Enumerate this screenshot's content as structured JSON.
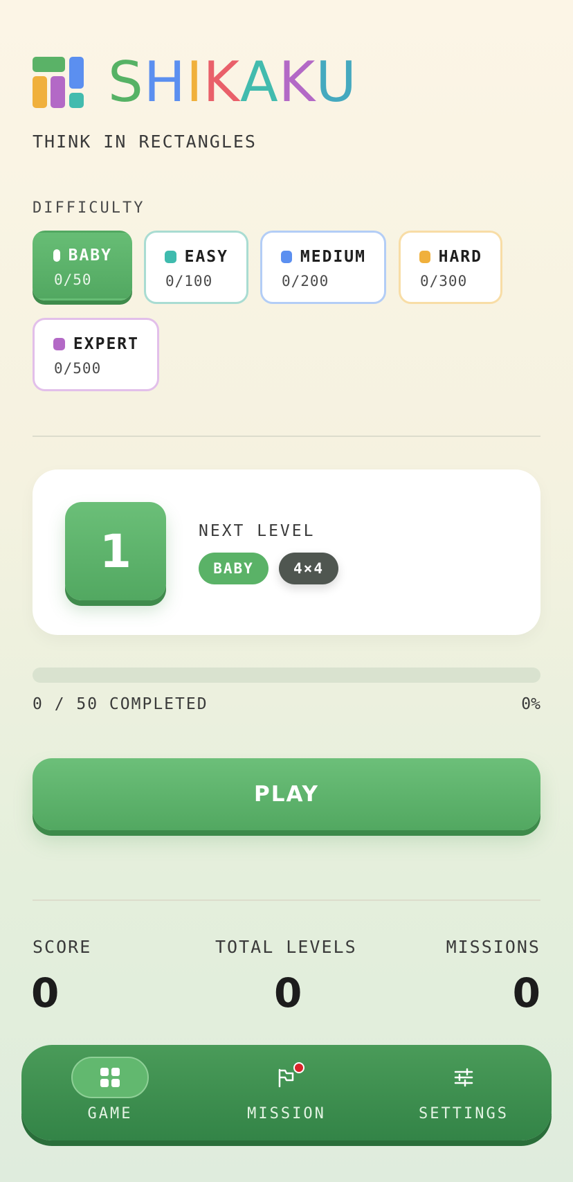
{
  "header": {
    "title_letters": [
      {
        "char": "S",
        "color": "#56b265"
      },
      {
        "char": "H",
        "color": "#5b8ff0"
      },
      {
        "char": "I",
        "color": "#f0b03c"
      },
      {
        "char": "K",
        "color": "#e9606a"
      },
      {
        "char": "A",
        "color": "#42bbae"
      },
      {
        "char": "K",
        "color": "#b369c6"
      },
      {
        "char": "U",
        "color": "#45a9bf"
      }
    ],
    "tagline": "THINK IN RECTANGLES"
  },
  "difficulty": {
    "label": "DIFFICULTY",
    "options": [
      {
        "name": "BABY",
        "count": "0/50",
        "color": "#5ab267",
        "selected": true
      },
      {
        "name": "EASY",
        "count": "0/100",
        "color": "#3fbbae",
        "selected": false
      },
      {
        "name": "MEDIUM",
        "count": "0/200",
        "color": "#5b8ff0",
        "selected": false
      },
      {
        "name": "HARD",
        "count": "0/300",
        "color": "#f0b03c",
        "selected": false
      },
      {
        "name": "EXPERT",
        "count": "0/500",
        "color": "#b369c6",
        "selected": false
      }
    ]
  },
  "next_level": {
    "number": "1",
    "label": "NEXT LEVEL",
    "difficulty_tag": "BABY",
    "grid_tag": "4×4"
  },
  "progress": {
    "text": "0 / 50 COMPLETED",
    "percent_text": "0%",
    "fraction": 0
  },
  "play_label": "PLAY",
  "stats": {
    "score_label": "SCORE",
    "score_value": "0",
    "levels_label": "TOTAL LEVELS",
    "levels_value": "0",
    "missions_label": "MISSIONS",
    "missions_value": "0"
  },
  "nav": {
    "items": [
      {
        "label": "GAME",
        "icon": "grid-icon",
        "active": true
      },
      {
        "label": "MISSION",
        "icon": "flag-icon",
        "active": false,
        "badge": true
      },
      {
        "label": "SETTINGS",
        "icon": "sliders-icon",
        "active": false
      }
    ]
  }
}
